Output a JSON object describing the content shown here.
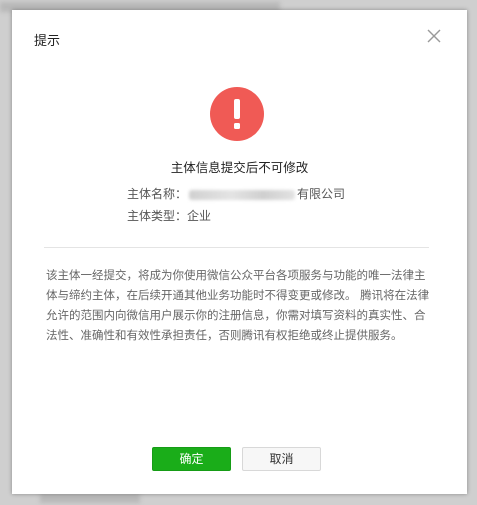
{
  "dialog": {
    "title": "提示",
    "headline": "主体信息提交后不可修改",
    "entity_name_label": "主体名称：",
    "entity_name_suffix": "有限公司",
    "entity_type_label": "主体类型：",
    "entity_type_value": "企业",
    "notice": "该主体一经提交，将成为你使用微信公众平台各项服务与功能的唯一法律主体与缔约主体，在后续开通其他业务功能时不得变更或修改。 腾讯将在法律允许的范围内向微信用户展示你的注册信息，你需对填写资料的真实性、合法性、准确性和有效性承担责任，否则腾讯有权拒绝或终止提供服务。",
    "confirm_label": "确定",
    "cancel_label": "取消"
  },
  "icons": {
    "close": "close-icon",
    "warning": "exclamation-circle-icon"
  },
  "colors": {
    "warning_red": "#f05a55",
    "primary_green": "#1aad19"
  }
}
